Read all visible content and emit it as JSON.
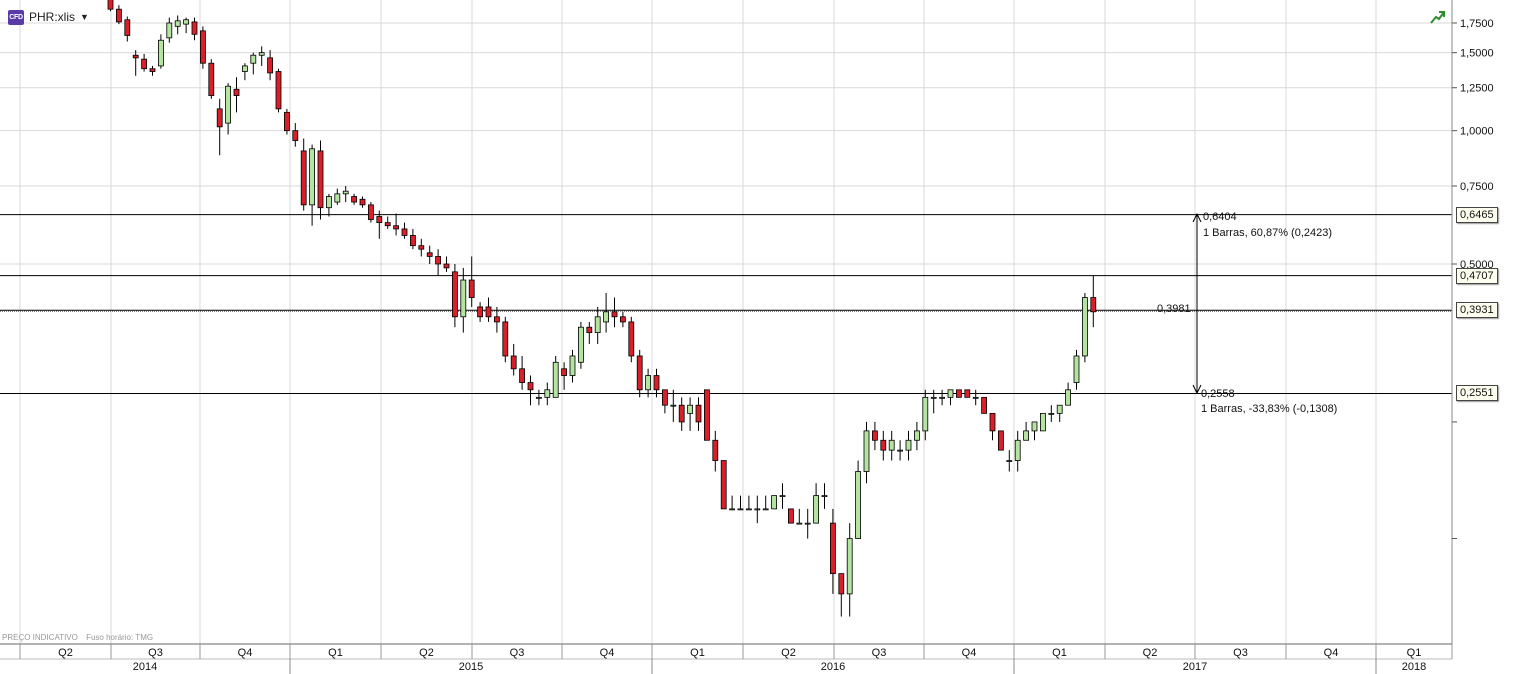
{
  "header": {
    "cfd_badge": "CFD",
    "symbol": "PHR:xlis",
    "dropdown_glyph": "▼",
    "trend_icon": "trend-up-icon"
  },
  "footer": {
    "indicative": "PREÇO INDICATIVO",
    "timezone": "Fuso horário: TMG"
  },
  "colors": {
    "up": "#b5e3a0",
    "down": "#d8202a",
    "grid": "#d9d9d9",
    "line": "#000000",
    "accent_icon": "#2e8b2e",
    "cfd_badge": "#5a3aa8"
  },
  "y_axis": {
    "scale": "log",
    "ticks": [
      {
        "value": 1.75,
        "label": "1,7500"
      },
      {
        "value": 1.5,
        "label": "1,5000"
      },
      {
        "value": 1.25,
        "label": "1,2500"
      },
      {
        "value": 1.0,
        "label": "1,0000"
      },
      {
        "value": 0.75,
        "label": "0,7500"
      },
      {
        "value": 0.5,
        "label": "0,5000"
      }
    ]
  },
  "price_tags": [
    "0,6465",
    "0,4707",
    "0,3931",
    "0,2551"
  ],
  "horizontal_lines": [
    0.6465,
    0.4707,
    0.3931,
    0.2551
  ],
  "measure": {
    "origin_label": "0,3981",
    "upper_value_label": "0,6404",
    "upper_stats": "1 Barras, 60,87% (0,2423)",
    "lower_value_label": "0,2558",
    "lower_stats": "1 Barras, -33,83% (-0,1308)"
  },
  "x_axis": {
    "quarters": [
      "Q2",
      "Q3",
      "Q4",
      "Q1",
      "Q2",
      "Q3",
      "Q4",
      "Q1",
      "Q2",
      "Q3",
      "Q4",
      "Q1",
      "Q2",
      "Q3",
      "Q4",
      "Q1"
    ],
    "years": [
      "2014",
      "2015",
      "2016",
      "2017",
      "2018"
    ]
  },
  "chart_data": {
    "type": "candlestick",
    "interval": "weekly",
    "y_scale": "log",
    "candles": [
      [
        2.0,
        2.05,
        1.86,
        1.88
      ],
      [
        1.88,
        1.92,
        1.74,
        1.76
      ],
      [
        1.78,
        1.81,
        1.59,
        1.64
      ],
      [
        1.48,
        1.52,
        1.33,
        1.46
      ],
      [
        1.45,
        1.49,
        1.36,
        1.38
      ],
      [
        1.38,
        1.4,
        1.33,
        1.36
      ],
      [
        1.4,
        1.65,
        1.38,
        1.6
      ],
      [
        1.62,
        1.8,
        1.58,
        1.75
      ],
      [
        1.72,
        1.82,
        1.65,
        1.77
      ],
      [
        1.74,
        1.8,
        1.66,
        1.78
      ],
      [
        1.76,
        1.8,
        1.6,
        1.65
      ],
      [
        1.68,
        1.72,
        1.38,
        1.42
      ],
      [
        1.42,
        1.45,
        1.18,
        1.2
      ],
      [
        1.12,
        1.18,
        0.88,
        1.02
      ],
      [
        1.04,
        1.28,
        0.98,
        1.26
      ],
      [
        1.24,
        1.32,
        1.1,
        1.2
      ],
      [
        1.36,
        1.42,
        1.3,
        1.4
      ],
      [
        1.42,
        1.5,
        1.34,
        1.48
      ],
      [
        1.48,
        1.55,
        1.4,
        1.5
      ],
      [
        1.46,
        1.52,
        1.3,
        1.35
      ],
      [
        1.36,
        1.38,
        1.1,
        1.12
      ],
      [
        1.1,
        1.12,
        0.98,
        1.0
      ],
      [
        1.0,
        1.04,
        0.92,
        0.95
      ],
      [
        0.9,
        0.96,
        0.66,
        0.68
      ],
      [
        0.68,
        0.93,
        0.61,
        0.91
      ],
      [
        0.9,
        0.95,
        0.63,
        0.67
      ],
      [
        0.67,
        0.72,
        0.64,
        0.71
      ],
      [
        0.69,
        0.74,
        0.68,
        0.72
      ],
      [
        0.72,
        0.75,
        0.69,
        0.73
      ],
      [
        0.71,
        0.72,
        0.68,
        0.69
      ],
      [
        0.7,
        0.71,
        0.67,
        0.68
      ],
      [
        0.68,
        0.69,
        0.62,
        0.63
      ],
      [
        0.64,
        0.66,
        0.57,
        0.62
      ],
      [
        0.62,
        0.64,
        0.6,
        0.61
      ],
      [
        0.61,
        0.65,
        0.58,
        0.6
      ],
      [
        0.6,
        0.62,
        0.57,
        0.58
      ],
      [
        0.58,
        0.6,
        0.54,
        0.55
      ],
      [
        0.55,
        0.57,
        0.52,
        0.54
      ],
      [
        0.53,
        0.55,
        0.5,
        0.52
      ],
      [
        0.52,
        0.54,
        0.47,
        0.5
      ],
      [
        0.5,
        0.52,
        0.48,
        0.49
      ],
      [
        0.48,
        0.5,
        0.36,
        0.38
      ],
      [
        0.38,
        0.49,
        0.35,
        0.46
      ],
      [
        0.46,
        0.52,
        0.4,
        0.42
      ],
      [
        0.4,
        0.41,
        0.37,
        0.38
      ],
      [
        0.4,
        0.42,
        0.37,
        0.38
      ],
      [
        0.38,
        0.4,
        0.35,
        0.37
      ],
      [
        0.37,
        0.38,
        0.3,
        0.31
      ],
      [
        0.31,
        0.33,
        0.28,
        0.29
      ],
      [
        0.29,
        0.31,
        0.26,
        0.27
      ],
      [
        0.27,
        0.28,
        0.24,
        0.26
      ],
      [
        0.25,
        0.26,
        0.24,
        0.25
      ],
      [
        0.25,
        0.27,
        0.24,
        0.26
      ],
      [
        0.25,
        0.31,
        0.25,
        0.3
      ],
      [
        0.29,
        0.3,
        0.26,
        0.28
      ],
      [
        0.28,
        0.32,
        0.27,
        0.31
      ],
      [
        0.3,
        0.37,
        0.29,
        0.36
      ],
      [
        0.36,
        0.37,
        0.33,
        0.35
      ],
      [
        0.35,
        0.4,
        0.33,
        0.38
      ],
      [
        0.37,
        0.43,
        0.35,
        0.39
      ],
      [
        0.39,
        0.42,
        0.36,
        0.38
      ],
      [
        0.38,
        0.39,
        0.36,
        0.37
      ],
      [
        0.37,
        0.38,
        0.3,
        0.31
      ],
      [
        0.31,
        0.32,
        0.25,
        0.26
      ],
      [
        0.26,
        0.29,
        0.25,
        0.28
      ],
      [
        0.28,
        0.29,
        0.25,
        0.26
      ],
      [
        0.26,
        0.26,
        0.23,
        0.24
      ],
      [
        0.24,
        0.26,
        0.22,
        0.24
      ],
      [
        0.24,
        0.25,
        0.21,
        0.22
      ],
      [
        0.23,
        0.25,
        0.21,
        0.24
      ],
      [
        0.24,
        0.25,
        0.21,
        0.22
      ],
      [
        0.26,
        0.26,
        0.2,
        0.2
      ],
      [
        0.2,
        0.21,
        0.17,
        0.18
      ],
      [
        0.18,
        0.18,
        0.14,
        0.14
      ],
      [
        0.14,
        0.15,
        0.14,
        0.14
      ],
      [
        0.14,
        0.15,
        0.14,
        0.14
      ],
      [
        0.14,
        0.15,
        0.14,
        0.14
      ],
      [
        0.14,
        0.15,
        0.13,
        0.14
      ],
      [
        0.14,
        0.15,
        0.14,
        0.14
      ],
      [
        0.14,
        0.15,
        0.14,
        0.15
      ],
      [
        0.15,
        0.16,
        0.14,
        0.15
      ],
      [
        0.14,
        0.14,
        0.13,
        0.13
      ],
      [
        0.13,
        0.14,
        0.13,
        0.13
      ],
      [
        0.13,
        0.14,
        0.12,
        0.13
      ],
      [
        0.13,
        0.16,
        0.13,
        0.15
      ],
      [
        0.15,
        0.16,
        0.14,
        0.15
      ],
      [
        0.13,
        0.14,
        0.09,
        0.1
      ],
      [
        0.1,
        0.1,
        0.08,
        0.09
      ],
      [
        0.09,
        0.13,
        0.08,
        0.12
      ],
      [
        0.12,
        0.18,
        0.12,
        0.17
      ],
      [
        0.17,
        0.22,
        0.16,
        0.21
      ],
      [
        0.21,
        0.22,
        0.19,
        0.2
      ],
      [
        0.2,
        0.21,
        0.18,
        0.19
      ],
      [
        0.19,
        0.21,
        0.18,
        0.2
      ],
      [
        0.19,
        0.2,
        0.18,
        0.19
      ],
      [
        0.19,
        0.21,
        0.18,
        0.2
      ],
      [
        0.2,
        0.22,
        0.19,
        0.21
      ],
      [
        0.21,
        0.26,
        0.2,
        0.25
      ],
      [
        0.25,
        0.26,
        0.23,
        0.25
      ],
      [
        0.25,
        0.26,
        0.24,
        0.25
      ],
      [
        0.25,
        0.26,
        0.24,
        0.26
      ],
      [
        0.26,
        0.26,
        0.25,
        0.25
      ],
      [
        0.26,
        0.26,
        0.25,
        0.25
      ],
      [
        0.25,
        0.26,
        0.24,
        0.25
      ],
      [
        0.25,
        0.25,
        0.23,
        0.23
      ],
      [
        0.23,
        0.23,
        0.2,
        0.21
      ],
      [
        0.21,
        0.21,
        0.19,
        0.19
      ],
      [
        0.18,
        0.19,
        0.17,
        0.18
      ],
      [
        0.18,
        0.21,
        0.17,
        0.2
      ],
      [
        0.2,
        0.22,
        0.2,
        0.21
      ],
      [
        0.21,
        0.22,
        0.2,
        0.22
      ],
      [
        0.21,
        0.23,
        0.21,
        0.23
      ],
      [
        0.23,
        0.24,
        0.22,
        0.23
      ],
      [
        0.23,
        0.24,
        0.22,
        0.24
      ],
      [
        0.24,
        0.27,
        0.24,
        0.26
      ],
      [
        0.27,
        0.32,
        0.26,
        0.31
      ],
      [
        0.31,
        0.43,
        0.3,
        0.42
      ],
      [
        0.42,
        0.47,
        0.36,
        0.39
      ]
    ]
  }
}
